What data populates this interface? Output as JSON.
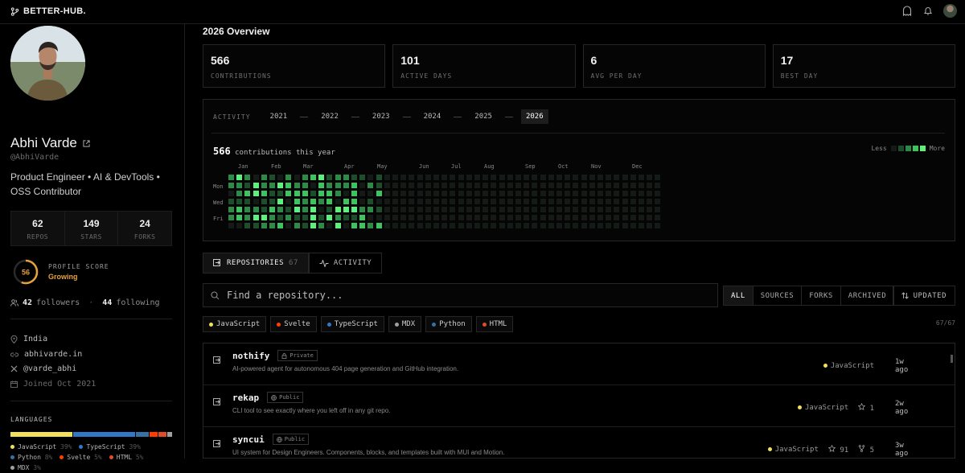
{
  "app": {
    "name": "BETTER-HUB."
  },
  "profile": {
    "name": "Abhi Varde",
    "handle": "@AbhiVarde",
    "bio": "Product Engineer • AI & DevTools • OSS Contributor",
    "stats": [
      {
        "value": "62",
        "label": "REPOS"
      },
      {
        "value": "149",
        "label": "STARS"
      },
      {
        "value": "24",
        "label": "FORKS"
      }
    ],
    "score": {
      "value": "56",
      "fraction": 0.56,
      "label": "PROFILE SCORE",
      "status": "Growing"
    },
    "followers": "42",
    "followers_label": "followers",
    "following": "44",
    "following_label": "following",
    "location": "India",
    "website": "abhivarde.in",
    "twitter": "@varde_abhi",
    "joined": "Joined Oct 2021"
  },
  "languages": {
    "title": "LANGUAGES",
    "items": [
      {
        "name": "JavaScript",
        "pct": "39%",
        "color": "#f1e05a"
      },
      {
        "name": "TypeScript",
        "pct": "39%",
        "color": "#3178c6"
      },
      {
        "name": "Python",
        "pct": "8%",
        "color": "#3572a5"
      },
      {
        "name": "Svelte",
        "pct": "5%",
        "color": "#ff3e00"
      },
      {
        "name": "HTML",
        "pct": "5%",
        "color": "#e34c26"
      },
      {
        "name": "MDX",
        "pct": "3%",
        "color": "#a0a0a0"
      }
    ]
  },
  "overview": {
    "title": "2026 Overview",
    "cards": [
      {
        "value": "566",
        "label": "CONTRIBUTIONS"
      },
      {
        "value": "101",
        "label": "ACTIVE DAYS"
      },
      {
        "value": "6",
        "label": "AVG PER DAY"
      },
      {
        "value": "17",
        "label": "BEST DAY"
      }
    ]
  },
  "activity": {
    "label": "ACTIVITY",
    "years": [
      "2021",
      "2022",
      "2023",
      "2024",
      "2025",
      "2026"
    ],
    "active_year": "2026",
    "contributions": "566",
    "contributions_text": "contributions this year",
    "less": "Less",
    "more": "More",
    "months": [
      "Jan",
      "Feb",
      "Mar",
      "Apr",
      "May",
      "Jun",
      "Jul",
      "Aug",
      "Sep",
      "Oct",
      "Nov",
      "Dec"
    ],
    "days": [
      "Mon",
      "Wed",
      "Fri"
    ]
  },
  "tabs": {
    "repositories": "REPOSITORIES",
    "repo_count": "67",
    "activity": "ACTIVITY"
  },
  "search": {
    "placeholder": "Find a repository..."
  },
  "filters": [
    "ALL",
    "SOURCES",
    "FORKS",
    "ARCHIVED"
  ],
  "sort": "UPDATED",
  "chips": [
    {
      "name": "JavaScript",
      "color": "#f1e05a"
    },
    {
      "name": "Svelte",
      "color": "#ff3e00"
    },
    {
      "name": "TypeScript",
      "color": "#3178c6"
    },
    {
      "name": "MDX",
      "color": "#a0a0a0"
    },
    {
      "name": "Python",
      "color": "#3572a5"
    },
    {
      "name": "HTML",
      "color": "#e34c26"
    }
  ],
  "count": "67/67",
  "repos": [
    {
      "name": "nothify",
      "visibility": "Private",
      "desc": "AI-powered agent for autonomous 404 page generation and GitHub integration.",
      "language": "JavaScript",
      "stars": "",
      "forks": "",
      "updated": "1w ago"
    },
    {
      "name": "rekap",
      "visibility": "Public",
      "desc": "CLI tool to see exactly where you left off in any git repo.",
      "language": "JavaScript",
      "stars": "1",
      "forks": "",
      "updated": "2w ago"
    },
    {
      "name": "syncui",
      "visibility": "Public",
      "desc": "UI system for Design Engineers. Components, blocks, and templates built with MUI and Motion.",
      "language": "JavaScript",
      "stars": "91",
      "forks": "5",
      "updated": "3w ago"
    }
  ]
}
